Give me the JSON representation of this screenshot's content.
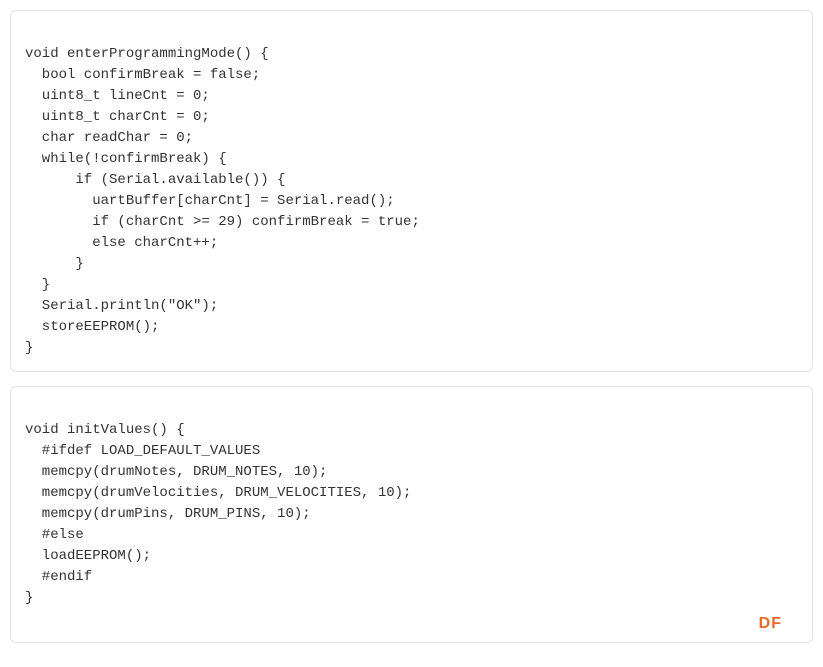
{
  "blocks": [
    {
      "lines": [
        "void enterProgrammingMode() {",
        "  bool confirmBreak = false;",
        "  uint8_t lineCnt = 0;",
        "  uint8_t charCnt = 0;",
        "  char readChar = 0;",
        "  while(!confirmBreak) {",
        "      if (Serial.available()) {",
        "        uartBuffer[charCnt] = Serial.read();",
        "        if (charCnt >= 29) confirmBreak = true;",
        "        else charCnt++;",
        "      }",
        "  }",
        "  Serial.println(\"OK\");",
        "  storeEEPROM();",
        "}"
      ]
    },
    {
      "lines": [
        "void initValues() {",
        "  #ifdef LOAD_DEFAULT_VALUES",
        "  memcpy(drumNotes, DRUM_NOTES, 10);",
        "  memcpy(drumVelocities, DRUM_VELOCITIES, 10);",
        "  memcpy(drumPins, DRUM_PINS, 10);",
        "  #else",
        "  loadEEPROM();",
        "  #endif",
        "}"
      ]
    }
  ],
  "blocks_joined": {
    "b0": "void enterProgrammingMode() {\n  bool confirmBreak = false;\n  uint8_t lineCnt = 0;\n  uint8_t charCnt = 0;\n  char readChar = 0;\n  while(!confirmBreak) {\n      if (Serial.available()) {\n        uartBuffer[charCnt] = Serial.read();\n        if (charCnt >= 29) confirmBreak = true;\n        else charCnt++;\n      }\n  }\n  Serial.println(\"OK\");\n  storeEEPROM();\n}",
    "b1": "void initValues() {\n  #ifdef LOAD_DEFAULT_VALUES\n  memcpy(drumNotes, DRUM_NOTES, 10);\n  memcpy(drumVelocities, DRUM_VELOCITIES, 10);\n  memcpy(drumPins, DRUM_PINS, 10);\n  #else\n  loadEEPROM();\n  #endif\n}"
  },
  "watermark": "DF"
}
